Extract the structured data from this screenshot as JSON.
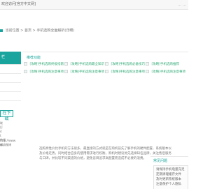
{
  "topbar": {
    "text": "欢迎访问[官方中文网]",
    "right_glyphs": [
      "…",
      "…"
    ]
  },
  "breadcrumb": {
    "text": "当前位置 > 首页 > 手机选购全面解析(详细)"
  },
  "sidebar": {
    "head": "栏",
    "items": [
      "",
      "",
      "",
      "",
      ""
    ],
    "download": "在下载",
    "contact": [
      "联",
      "打",
      "4",
      "t",
      "http://www.",
      "邮..."
    ],
    "bottom": [
      "热线",
      "新浪微博"
    ]
  },
  "feature": {
    "title": "推荐功能",
    "items": [
      {
        "label": "[攻略]手机选购终极指南"
      },
      {
        "label": "[攻略]手机选购最全知识"
      },
      {
        "label": "[攻略]手机选购必备技巧"
      },
      {
        "label": "[攻略]手机选购推荐"
      },
      {
        "label": "[攻略]手机选购注意事项"
      },
      {
        "label": "[攻略]手机选购注意事项"
      },
      {
        "label": "[攻略]手机选购注意事项"
      },
      {
        "label": "[攻略]手机选购注意事项"
      }
    ]
  },
  "content": {
    "paragraph": "选购高性价比手机的方法很多，最直接的方式就是在购机前先了解手机的硬件配置、系统版本以及价格走势，同时结合自身的使用需求进行权衡。购机时建议优先选择知名品牌，关注售后服务与口碑，并比较不同渠道的价格，避免盲目追求高配置而造成不必要的浪费。"
  },
  "faq": {
    "title": "常见问题",
    "lines": [
      "请保持手机电量充足",
      "定期清理缓存文件",
      "及时更新系统版本",
      "注意保护个人隐私"
    ]
  }
}
